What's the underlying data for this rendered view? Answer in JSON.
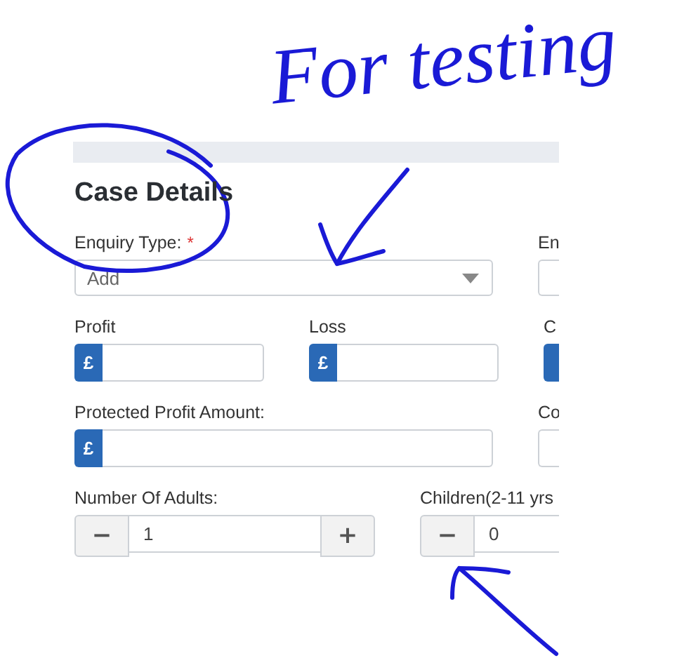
{
  "annotation": {
    "text": "For testing"
  },
  "section": {
    "title": "Case Details"
  },
  "rows": [
    {
      "fields": [
        {
          "kind": "select",
          "label": "Enquiry Type:",
          "required_mark": "*",
          "placeholder": "Add"
        },
        {
          "kind": "select",
          "label": "En"
        }
      ]
    },
    {
      "fields": [
        {
          "kind": "currency",
          "label": "Profit",
          "symbol": "£"
        },
        {
          "kind": "currency",
          "label": "Loss",
          "symbol": "£"
        },
        {
          "kind": "currency",
          "label": "C"
        }
      ]
    },
    {
      "fields": [
        {
          "kind": "currency",
          "label": "Protected Profit Amount:",
          "symbol": "£"
        },
        {
          "kind": "text",
          "label": "Co"
        }
      ]
    },
    {
      "fields": [
        {
          "kind": "stepper",
          "label": "Number Of Adults:",
          "value": "1",
          "minus": "−",
          "plus": "+"
        },
        {
          "kind": "stepper",
          "label": "Children(2-11 yrs",
          "value": "0",
          "minus": "−"
        }
      ]
    }
  ]
}
